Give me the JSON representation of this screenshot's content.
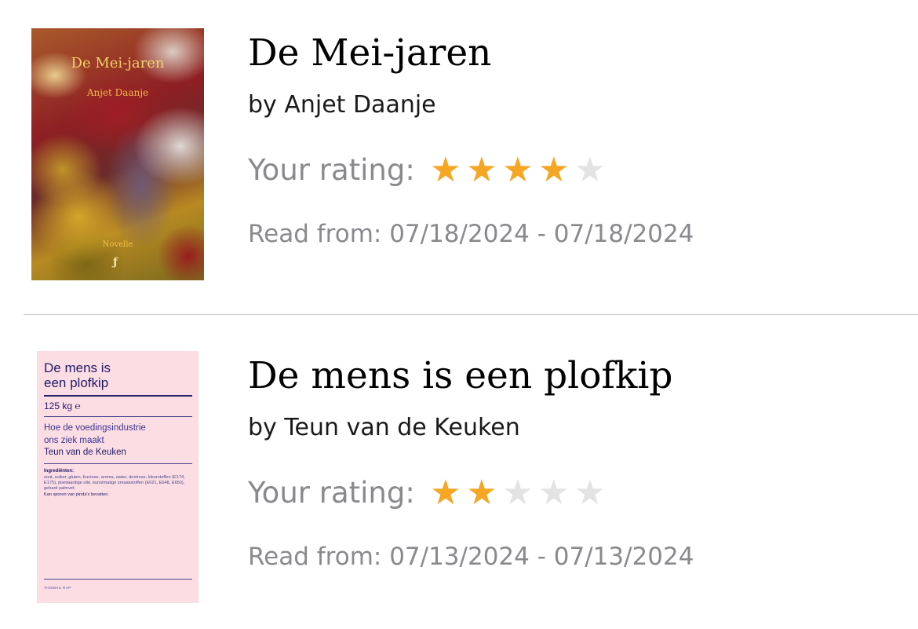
{
  "colors": {
    "star_filled": "#F5A623",
    "star_empty": "#E3E3E3",
    "secondary_text": "#8A8A8E",
    "divider": "#CFCFCF"
  },
  "books": [
    {
      "title": "De Mei-jaren",
      "author_line": "by Anjet Daanje",
      "rating_label": "Your rating:",
      "rating": 4,
      "rating_max": 5,
      "read_dates": "Read from: 07/18/2024 - 07/18/2024",
      "cover": {
        "title": "De Mei-jaren",
        "author": "Anjet Daanje",
        "imprint": "Novelle",
        "logo": "ƒ"
      }
    },
    {
      "title": "De mens is een plofkip",
      "author_line": "by Teun van de Keuken",
      "rating_label": "Your rating:",
      "rating": 2,
      "rating_max": 5,
      "read_dates": "Read from: 07/13/2024 - 07/13/2024",
      "cover": {
        "title_line1": "De mens is",
        "title_line2": "een plofkip",
        "weight": "125 kg ℮",
        "subtitle_line1": "Hoe de voedingsindustrie",
        "subtitle_line2": "ons ziek maakt",
        "author": "Teun van de Keuken",
        "ingredients_heading": "Ingrediënten:",
        "ingredients_text": "zout, suiker, gluten, fructose, aroma, water, dextrose, kleurstoffen (E174, E175), plantaardige olie, kunstmatige smaakstoffen (E621, E648, E650), gehard palmvet.",
        "allergen_note": "Kan sporen van pinda's bevatten.",
        "publisher": "THOMAS RAP"
      }
    }
  ]
}
